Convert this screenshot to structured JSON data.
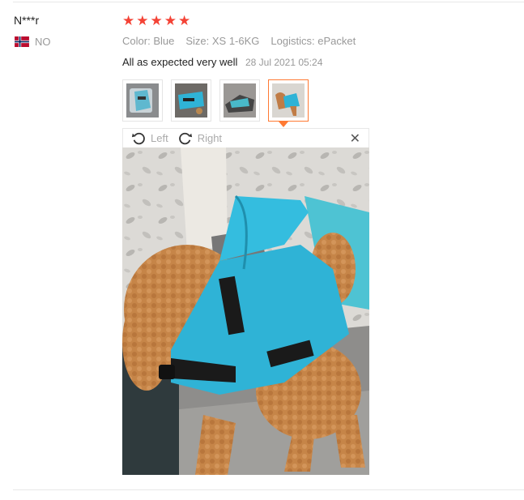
{
  "reviewer": {
    "name": "N***r",
    "country_code": "NO"
  },
  "review": {
    "stars": [
      "★",
      "★",
      "★",
      "★",
      "★"
    ],
    "attributes": [
      {
        "key": "Color:",
        "value": "Blue"
      },
      {
        "key": "Size:",
        "value": "XS 1-6KG"
      },
      {
        "key": "Logistics:",
        "value": "ePacket"
      }
    ],
    "text": "All as expected very well",
    "date": "28 Jul 2021 05:24"
  },
  "viewer": {
    "rotate_left_label": "Left",
    "rotate_right_label": "Right",
    "close_glyph": "✕"
  },
  "colors": {
    "star": "#f44336",
    "accent": "#ff7a33",
    "muted": "#999999",
    "vest": "#2fb3d6"
  }
}
